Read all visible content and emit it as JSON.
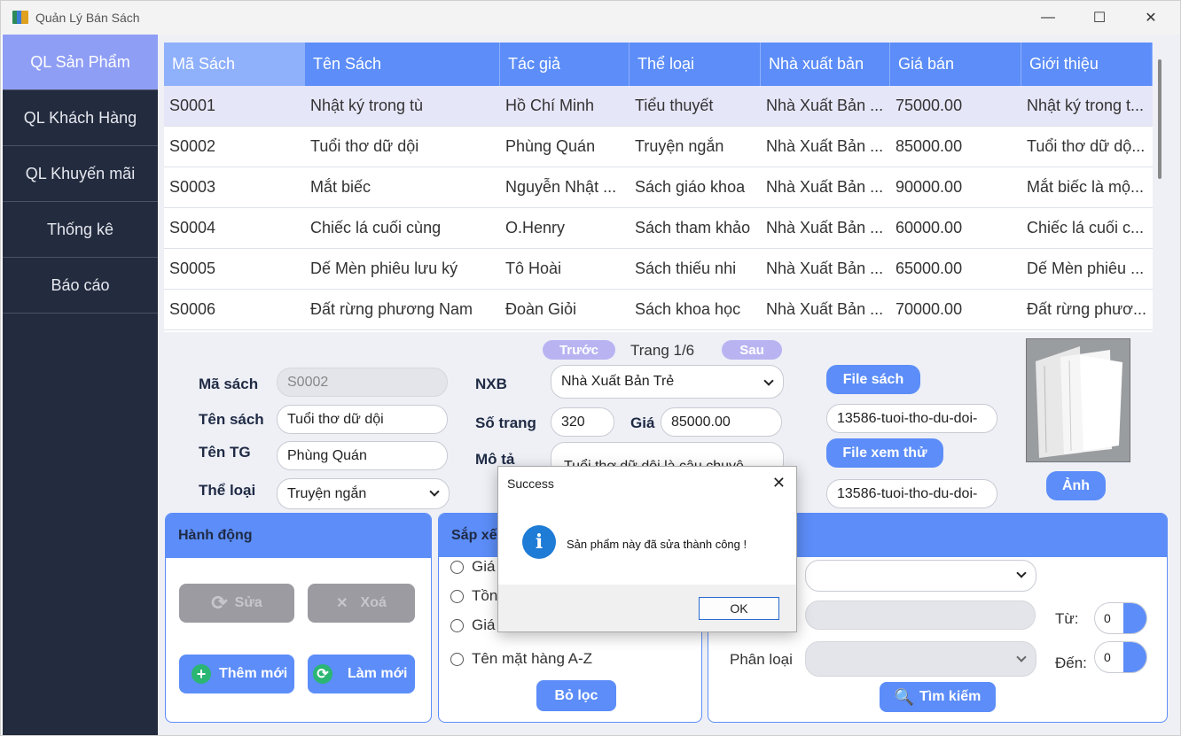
{
  "window": {
    "title": "Quản Lý Bán Sách"
  },
  "sidebar": {
    "items": [
      {
        "label": "QL Sản Phẩm",
        "active": true
      },
      {
        "label": "QL Khách Hàng"
      },
      {
        "label": "QL Khuyến mãi"
      },
      {
        "label": "Thống kê"
      },
      {
        "label": "Báo cáo"
      }
    ]
  },
  "table": {
    "headers": [
      "Mã Sách",
      "Tên Sách",
      "Tác giả",
      "Thể loại",
      "Nhà xuất bản",
      "Giá bán",
      "Giới thiệu"
    ],
    "rows": [
      [
        "S0001",
        "Nhật ký trong tù",
        "Hồ Chí Minh",
        "Tiểu thuyết",
        "Nhà Xuất Bản ...",
        "75000.00",
        "Nhật ký trong t..."
      ],
      [
        "S0002",
        "Tuổi thơ dữ dội",
        "Phùng Quán",
        "Truyện ngắn",
        "Nhà Xuất Bản ...",
        "85000.00",
        "Tuổi thơ dữ dộ..."
      ],
      [
        "S0003",
        "Mắt biếc",
        "Nguyễn Nhật ...",
        "Sách giáo khoa",
        "Nhà Xuất Bản ...",
        "90000.00",
        "Mắt biếc là mộ..."
      ],
      [
        "S0004",
        "Chiếc lá cuối cùng",
        "O.Henry",
        "Sách tham khảo",
        "Nhà Xuất Bản ...",
        "60000.00",
        "Chiếc lá cuối c..."
      ],
      [
        "S0005",
        "Dế Mèn phiêu lưu ký",
        "Tô Hoài",
        "Sách thiếu nhi",
        "Nhà Xuất Bản ...",
        "65000.00",
        "Dế Mèn phiêu ..."
      ],
      [
        "S0006",
        "Đất rừng phương Nam",
        "Đoàn Giỏi",
        "Sách khoa học",
        "Nhà Xuất Bản ...",
        "70000.00",
        "Đất rừng phươ..."
      ]
    ]
  },
  "pagination": {
    "prev": "Trước",
    "page": "Trang 1/6",
    "next": "Sau"
  },
  "form": {
    "ma_sach_label": "Mã sách",
    "ma_sach": "S0002",
    "ten_sach_label": "Tên sách",
    "ten_sach": "Tuổi thơ dữ dội",
    "ten_tg_label": "Tên TG",
    "ten_tg": "Phùng Quán",
    "the_loai_label": "Thể loại",
    "the_loai": "Truyện ngắn",
    "nxb_label": "NXB",
    "nxb": "Nhà Xuất Bản Trẻ",
    "so_trang_label": "Số trang",
    "so_trang": "320",
    "gia_label": "Giá",
    "gia": "85000.00",
    "mo_ta_label": "Mô tả",
    "mo_ta": "Tuổi thơ dữ dội là câu chuyệ",
    "file_sach_btn": "File sách",
    "file_sach": "13586-tuoi-tho-du-doi-",
    "file_xem_thu_btn": "File xem thử",
    "file_xem_thu": "13586-tuoi-tho-du-doi-",
    "anh_btn": "Ảnh"
  },
  "actions": {
    "title": "Hành động",
    "edit": "Sửa",
    "delete": "Xoá",
    "add": "Thêm mới",
    "refresh": "Làm mới"
  },
  "sort": {
    "title": "Sắp xếp",
    "options": [
      "Giá",
      "Tồn",
      "Giá",
      "Tên mặt hàng A-Z"
    ],
    "clear": "Bỏ lọc"
  },
  "search": {
    "category_label": "Phân loại",
    "from_label": "Từ:",
    "to_label": "Đến:",
    "from_value": "0",
    "to_value": "0",
    "button": "Tìm kiếm"
  },
  "dialog": {
    "title": "Success",
    "message": "Sản phẩm này đã sửa thành công !",
    "ok": "OK"
  }
}
